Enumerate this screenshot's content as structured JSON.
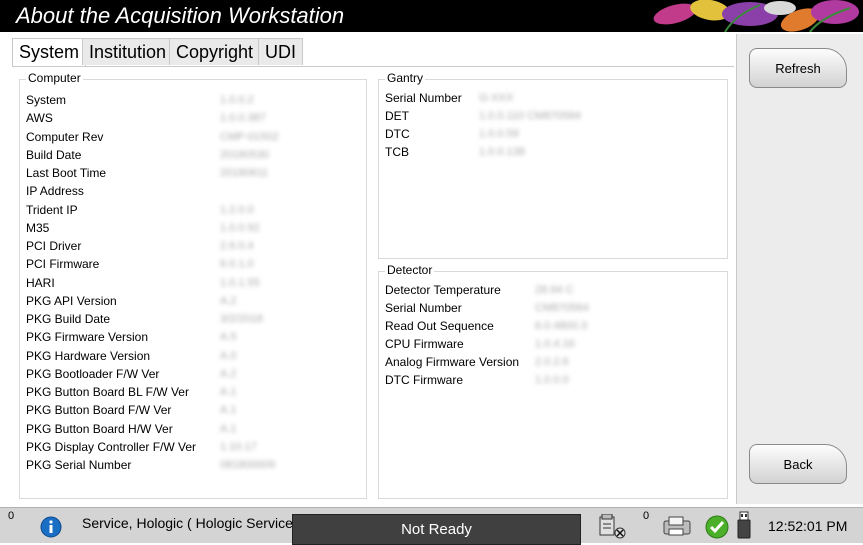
{
  "window": {
    "title": "About the Acquisition Workstation"
  },
  "tabs": [
    "System",
    "Institution",
    "Copyright",
    "UDI"
  ],
  "active_tab": "System",
  "computer": {
    "title": "Computer",
    "rows": [
      {
        "label": "System",
        "value": "1.0.0.2"
      },
      {
        "label": "AWS",
        "value": "1.0.0.387"
      },
      {
        "label": "Computer Rev",
        "value": "CMP-01502"
      },
      {
        "label": "Build Date",
        "value": "20180530"
      },
      {
        "label": "Last Boot Time",
        "value": "20180611"
      },
      {
        "label": "IP Address",
        "value": ""
      },
      {
        "label": "Trident IP",
        "value": "1.2.0.0"
      },
      {
        "label": "M35",
        "value": "1.0.0.92"
      },
      {
        "label": "PCI Driver",
        "value": "2.6.0.4"
      },
      {
        "label": "PCI Firmware",
        "value": "6.0.1.0"
      },
      {
        "label": "HARI",
        "value": "1.0.1.55"
      },
      {
        "label": "PKG API Version",
        "value": "A.2"
      },
      {
        "label": "PKG Build Date",
        "value": "3/2/2018"
      },
      {
        "label": "PKG Firmware Version",
        "value": "A.5"
      },
      {
        "label": "PKG Hardware Version",
        "value": "A.0"
      },
      {
        "label": "PKG Bootloader F/W Ver",
        "value": "A.2"
      },
      {
        "label": "PKG Button Board BL F/W Ver",
        "value": "A.1"
      },
      {
        "label": "PKG Button Board F/W Ver",
        "value": "A.1"
      },
      {
        "label": "PKG Button Board H/W Ver",
        "value": "A.1"
      },
      {
        "label": "PKG Display Controller F/W Ver",
        "value": "1.10.17"
      },
      {
        "label": "PKG Serial Number",
        "value": "081800009"
      }
    ]
  },
  "gantry": {
    "title": "Gantry",
    "rows": [
      {
        "label": "Serial Number",
        "value": "G-XXX"
      },
      {
        "label": "DET",
        "value": "1.0.0.110   CM870564"
      },
      {
        "label": "DTC",
        "value": "1.0.0.59"
      },
      {
        "label": "TCB",
        "value": "1.0.0.138"
      }
    ]
  },
  "detector": {
    "title": "Detector",
    "rows": [
      {
        "label": "Detector Temperature",
        "value": "28.94 C"
      },
      {
        "label": "Serial Number",
        "value": "CM870564"
      },
      {
        "label": "Read Out Sequence",
        "value": "6.0.4800.3"
      },
      {
        "label": "CPU Firmware",
        "value": "1.0.4.16"
      },
      {
        "label": "Analog Firmware Version",
        "value": "2.0.2.6"
      },
      {
        "label": "DTC Firmware",
        "value": "1.0.0.0"
      }
    ]
  },
  "buttons": {
    "refresh": "Refresh",
    "back": "Back"
  },
  "status_bar": {
    "count_left": "0",
    "user": "Service, Hologic ( Hologic Service )",
    "state": "Not Ready",
    "count_right": "0",
    "time": "12:52:01 PM"
  },
  "icons": [
    "info-icon",
    "output-device-icon",
    "print-queue-icon",
    "check-icon",
    "usb-icon"
  ],
  "colors": {
    "titlebar": "#000000",
    "state_bg": "#404040",
    "check": "#4caf2a",
    "info": "#1a6fc4"
  }
}
